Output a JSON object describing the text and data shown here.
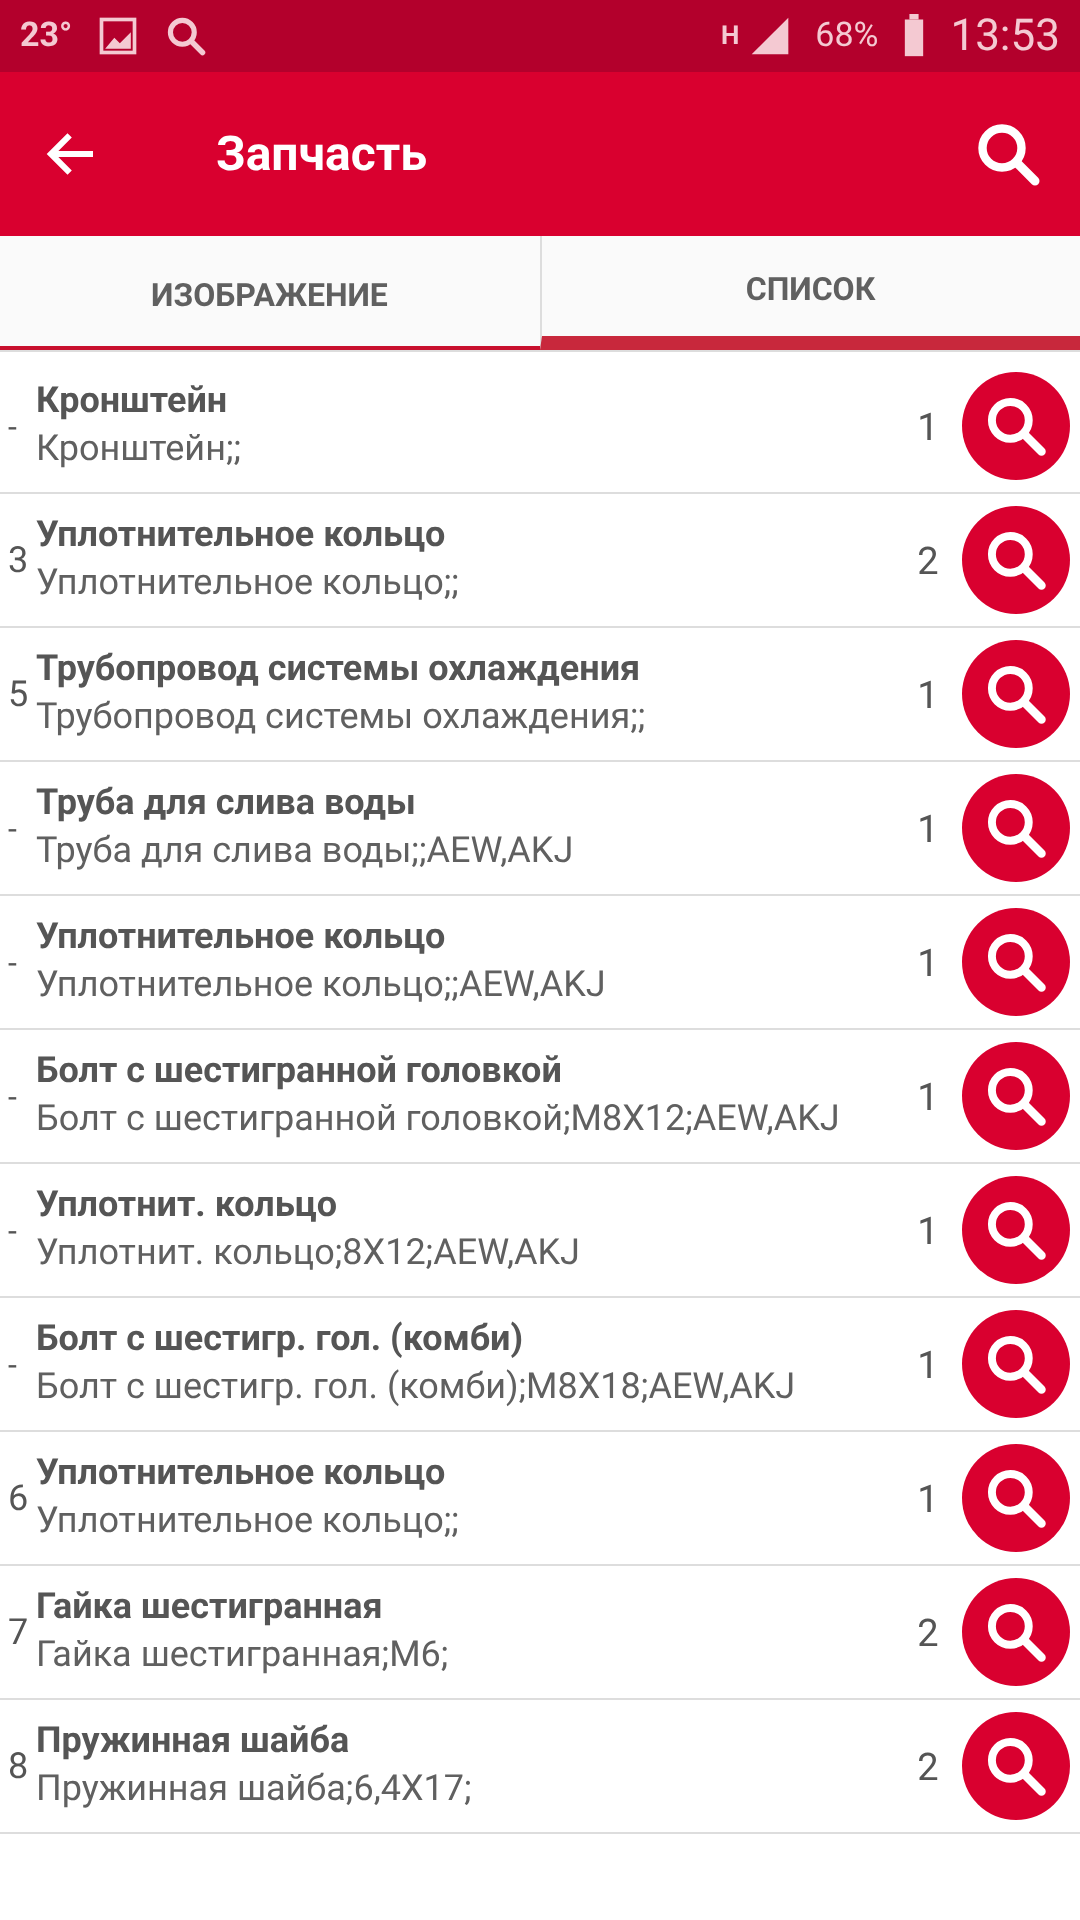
{
  "status_bar": {
    "temperature": "23°",
    "network_type": "H",
    "battery": "68%",
    "time": "13:53"
  },
  "app_bar": {
    "title": "Запчасть"
  },
  "tabs": [
    {
      "label": "ИЗОБРАЖЕНИЕ",
      "selected": false
    },
    {
      "label": "СПИСОК",
      "selected": true
    }
  ],
  "rows": [
    {
      "index": "-",
      "title": "Кронштейн",
      "description": "Кронштейн;;",
      "qty": "1"
    },
    {
      "index": "3",
      "title": "Уплотнительное кольцо",
      "description": "Уплотнительное кольцо;;",
      "qty": "2"
    },
    {
      "index": "5",
      "title": "Трубопровод системы охлаждения",
      "description": "Трубопровод системы охлаждения;;",
      "qty": "1"
    },
    {
      "index": "-",
      "title": "Труба для слива воды",
      "description": "Труба для слива воды;;AEW,AKJ",
      "qty": "1"
    },
    {
      "index": "-",
      "title": "Уплотнительное кольцо",
      "description": "Уплотнительное кольцо;;AEW,AKJ",
      "qty": "1"
    },
    {
      "index": "-",
      "title": "Болт с шестигранной головкой",
      "description": "Болт с шестигранной головкой;M8X12;AEW,AKJ",
      "qty": "1"
    },
    {
      "index": "-",
      "title": "Уплотнит. кольцо",
      "description": "Уплотнит. кольцо;8X12;AEW,AKJ",
      "qty": "1"
    },
    {
      "index": "-",
      "title": "Болт с шестигр. гол. (комби)",
      "description": "Болт с шестигр. гол. (комби);M8X18;AEW,AKJ",
      "qty": "1"
    },
    {
      "index": "6",
      "title": "Уплотнительное кольцо",
      "description": "Уплотнительное кольцо;;",
      "qty": "1"
    },
    {
      "index": "7",
      "title": "Гайка шестигранная",
      "description": "Гайка шестигранная;M6;",
      "qty": "2"
    },
    {
      "index": "8",
      "title": "Пружинная шайба",
      "description": "Пружинная шайба;6,4X17;",
      "qty": "2"
    }
  ]
}
